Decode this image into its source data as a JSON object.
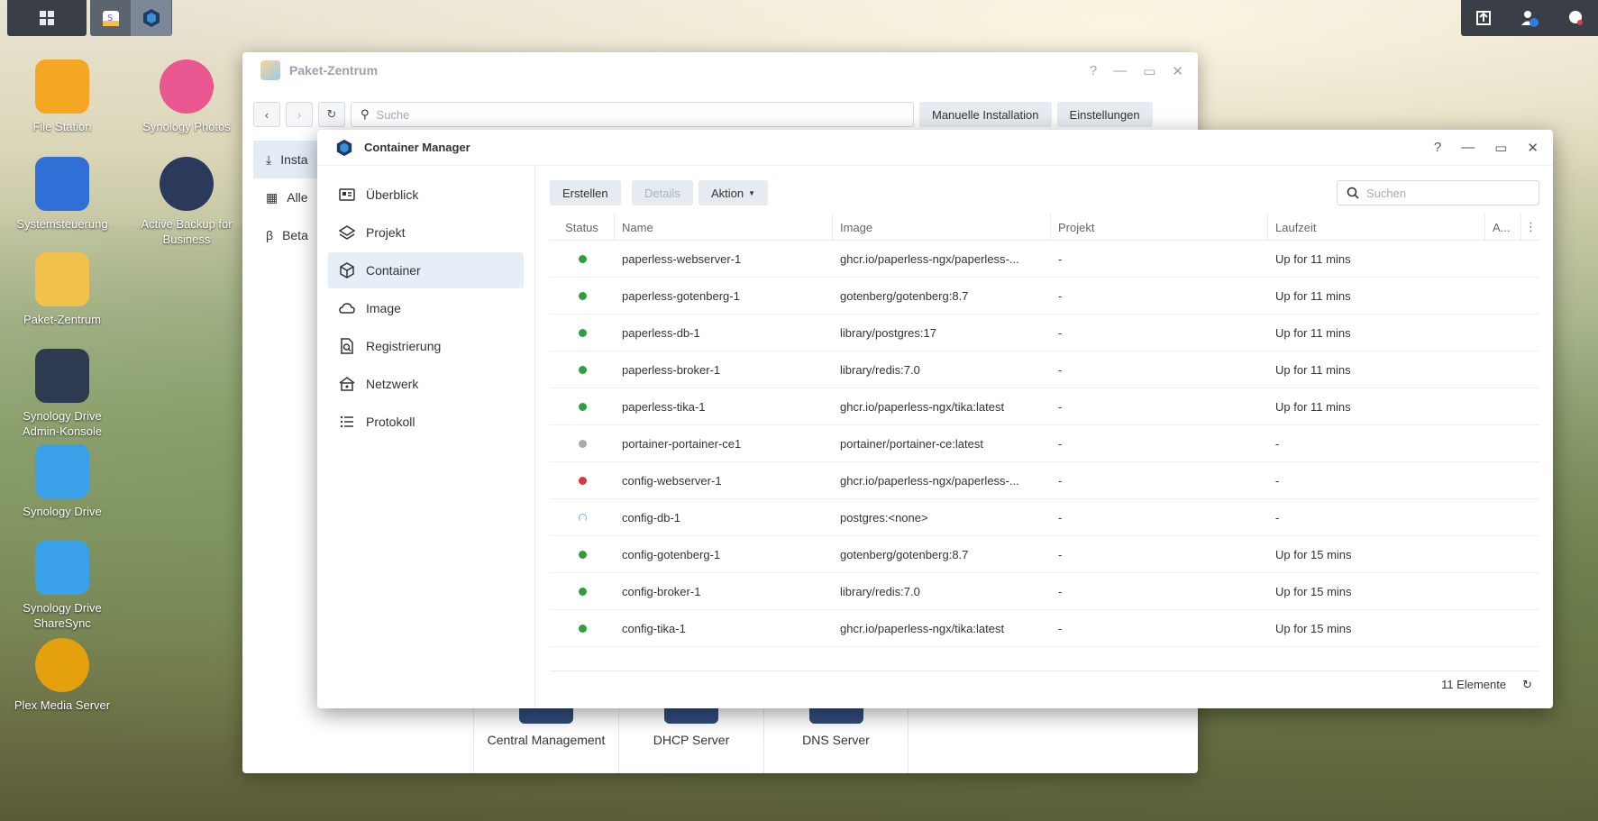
{
  "taskbar": {
    "main_menu_icon": "grid-icon",
    "apps": [
      "package-center-icon",
      "container-manager-icon"
    ],
    "right_icons": [
      "upload-icon",
      "user-power-icon",
      "chat-icon"
    ]
  },
  "desktop": {
    "icons": [
      {
        "label": "File Station",
        "icon": "folder-icon",
        "color": "#f5a623"
      },
      {
        "label": "Synology Photos",
        "icon": "photos-icon",
        "color": "#e8578f"
      },
      {
        "label": "Systemsteuerung",
        "icon": "control-panel-icon",
        "color": "#2f6fd6"
      },
      {
        "label": "Active Backup for Business",
        "icon": "backup-icon",
        "color": "#2b3a5a"
      },
      {
        "label": "Paket-Zentrum",
        "icon": "package-center-icon",
        "color": "#f0c14b"
      },
      {
        "label": "Synology Drive Admin-Konsole",
        "icon": "drive-admin-icon",
        "color": "#2d3a4f"
      },
      {
        "label": "Synology Drive",
        "icon": "drive-icon",
        "color": "#3aa0e8"
      },
      {
        "label": "Synology Drive ShareSync",
        "icon": "sharesync-icon",
        "color": "#3aa0e8"
      },
      {
        "label": "Plex Media Server",
        "icon": "plex-icon",
        "color": "#e5a00d"
      }
    ]
  },
  "package_center": {
    "title": "Paket-Zentrum",
    "search_placeholder": "Suche",
    "manual_install": "Manuelle Installation",
    "settings": "Einstellungen",
    "sidebar": [
      "Insta",
      "Alle",
      "Beta"
    ],
    "packages": [
      "Central\nManagement",
      "DHCP Server",
      "DNS Server"
    ]
  },
  "container_manager": {
    "title": "Container Manager",
    "nav": [
      {
        "label": "Überblick",
        "icon": "overview-icon"
      },
      {
        "label": "Projekt",
        "icon": "layers-icon"
      },
      {
        "label": "Container",
        "icon": "cube-icon",
        "active": true
      },
      {
        "label": "Image",
        "icon": "cloud-icon"
      },
      {
        "label": "Registrierung",
        "icon": "registry-search-icon"
      },
      {
        "label": "Netzwerk",
        "icon": "network-icon"
      },
      {
        "label": "Protokoll",
        "icon": "list-icon"
      }
    ],
    "toolbar": {
      "create": "Erstellen",
      "details": "Details",
      "action": "Aktion"
    },
    "search_placeholder": "Suchen",
    "columns": [
      "Status",
      "Name",
      "Image",
      "Projekt",
      "Laufzeit",
      "A..."
    ],
    "status_colors": {
      "running": "#2e9e3e",
      "stopped": "#aaaaaa",
      "error": "#d9363e",
      "pending": "#7aaed6"
    },
    "rows": [
      {
        "status": "running",
        "name": "paperless-webserver-1",
        "image": "ghcr.io/paperless-ngx/paperless-...",
        "project": "-",
        "uptime": "Up for 11 mins"
      },
      {
        "status": "running",
        "name": "paperless-gotenberg-1",
        "image": "gotenberg/gotenberg:8.7",
        "project": "-",
        "uptime": "Up for 11 mins"
      },
      {
        "status": "running",
        "name": "paperless-db-1",
        "image": "library/postgres:17",
        "project": "-",
        "uptime": "Up for 11 mins"
      },
      {
        "status": "running",
        "name": "paperless-broker-1",
        "image": "library/redis:7.0",
        "project": "-",
        "uptime": "Up for 11 mins"
      },
      {
        "status": "running",
        "name": "paperless-tika-1",
        "image": "ghcr.io/paperless-ngx/tika:latest",
        "project": "-",
        "uptime": "Up for 11 mins"
      },
      {
        "status": "stopped",
        "name": "portainer-portainer-ce1",
        "image": "portainer/portainer-ce:latest",
        "project": "-",
        "uptime": "-"
      },
      {
        "status": "error",
        "name": "config-webserver-1",
        "image": "ghcr.io/paperless-ngx/paperless-...",
        "project": "-",
        "uptime": "-"
      },
      {
        "status": "pending",
        "name": "config-db-1",
        "image": "postgres:<none>",
        "project": "-",
        "uptime": "-"
      },
      {
        "status": "running",
        "name": "config-gotenberg-1",
        "image": "gotenberg/gotenberg:8.7",
        "project": "-",
        "uptime": "Up for 15 mins"
      },
      {
        "status": "running",
        "name": "config-broker-1",
        "image": "library/redis:7.0",
        "project": "-",
        "uptime": "Up for 15 mins"
      },
      {
        "status": "running",
        "name": "config-tika-1",
        "image": "ghcr.io/paperless-ngx/tika:latest",
        "project": "-",
        "uptime": "Up for 15 mins"
      }
    ],
    "footer_count": "11 Elemente"
  }
}
